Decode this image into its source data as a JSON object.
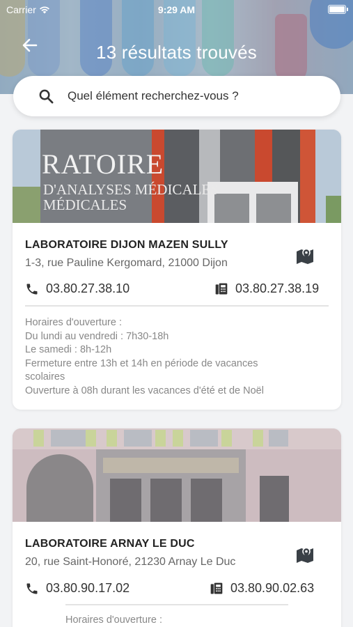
{
  "status_bar": {
    "carrier": "Carrier",
    "time": "9:29 AM"
  },
  "header": {
    "title": "13 résultats trouvés"
  },
  "search": {
    "placeholder": "Quel élément recherchez-vous ?"
  },
  "colors": {
    "accent": "#ffffff",
    "text_dark": "#222222",
    "text_muted": "#888888",
    "background": "#f2f3f5"
  },
  "results": [
    {
      "name": "LABORATOIRE DIJON MAZEN SULLY",
      "address": "1-3, rue Pauline Kergomard, 21000 Dijon",
      "phone": "03.80.27.38.10",
      "fax": "03.80.27.38.19",
      "hours_title": "Horaires d'ouverture :",
      "hours": [
        "Du lundi au vendredi : 7h30-18h",
        "Le samedi : 8h-12h",
        "Fermeture entre 13h et 14h en période de vacances",
        "scolaires",
        "Ouverture à 08h durant les vacances d'été et de Noël"
      ],
      "photo_sign_1": "RATOIRE",
      "photo_sign_2": "D'ANALYSES MÉDICALES",
      "photo_sign_3": "MÉDICALES"
    },
    {
      "name": "LABORATOIRE ARNAY LE DUC",
      "address": "20, rue Saint-Honoré, 21230  Arnay Le Duc",
      "phone": "03.80.90.17.02",
      "fax": "03.80.90.02.63",
      "hours_title": "Horaires d'ouverture :"
    }
  ]
}
